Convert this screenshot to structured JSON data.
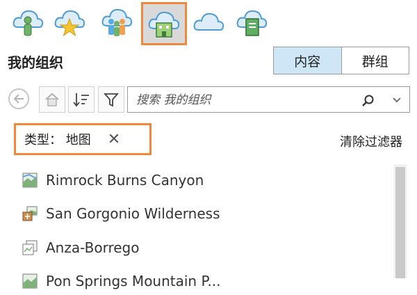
{
  "portal_tabs": [
    {
      "icon": "my-content-icon",
      "active": false
    },
    {
      "icon": "favorites-icon",
      "active": false
    },
    {
      "icon": "my-groups-icon",
      "active": false
    },
    {
      "icon": "my-organization-icon",
      "active": true
    },
    {
      "icon": "arcgis-online-icon",
      "active": false
    },
    {
      "icon": "living-atlas-icon",
      "active": false
    }
  ],
  "header": {
    "title": "我的组织"
  },
  "view_toggle": {
    "content_label": "内容",
    "groups_label": "群组",
    "selected": "内容"
  },
  "search": {
    "placeholder": "搜索 我的组织"
  },
  "filter": {
    "chip_label": "类型：  地图",
    "clear_label": "清除过滤器"
  },
  "items": [
    {
      "label": "Rimrock Burns Canyon",
      "icon": "map-icon"
    },
    {
      "label": "San Gorgonio Wilderness",
      "icon": "map-package-icon"
    },
    {
      "label": "Anza-Borrego",
      "icon": "mobile-map-icon"
    },
    {
      "label": "Pon Springs Mountain P...",
      "icon": "map-icon"
    }
  ],
  "colors": {
    "accent_orange": "#f0883c",
    "selected_tab": "#cfe6f7",
    "cloud_blue": "#5aa9e0"
  }
}
